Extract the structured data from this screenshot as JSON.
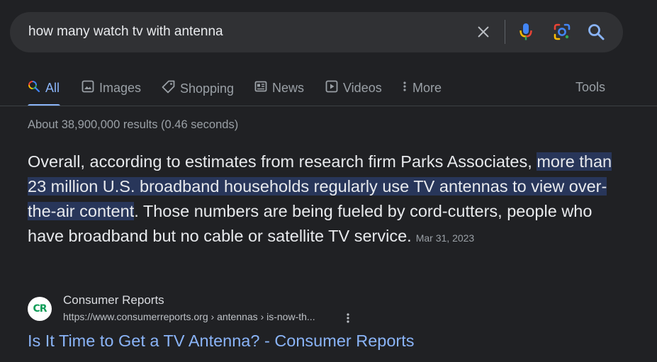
{
  "search": {
    "query": "how many watch tv with antenna"
  },
  "tabs": [
    {
      "label": "All"
    },
    {
      "label": "Images"
    },
    {
      "label": "Shopping"
    },
    {
      "label": "News"
    },
    {
      "label": "Videos"
    },
    {
      "label": "More"
    }
  ],
  "tools_label": "Tools",
  "stats": "About 38,900,000 results (0.46 seconds)",
  "snippet": {
    "before": "Overall, according to estimates from research firm Parks Associates, ",
    "highlight": "more than 23 million U.S. broadband households regularly use TV antennas to view over-the-air content",
    "after": ". Those numbers are being fueled by cord-cutters, people who have broadband but no cable or satellite TV service.",
    "date": "Mar 31, 2023"
  },
  "source": {
    "favicon_text": "CR",
    "name": "Consumer Reports",
    "url": "https://www.consumerreports.org › antennas › is-now-th..."
  },
  "result": {
    "title": "Is It Time to Get a TV Antenna? - Consumer Reports"
  },
  "colors": {
    "background": "#202124",
    "link": "#8ab4f8",
    "highlight": "#28365a"
  }
}
